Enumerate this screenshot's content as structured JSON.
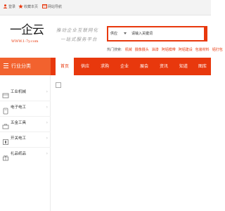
{
  "topbar": {
    "links": [
      {
        "label": "登录",
        "icon": "user-icon"
      },
      {
        "label": "收藏本页",
        "icon": "star-icon"
      },
      {
        "label": "网站导航",
        "icon": "sitemap-icon"
      }
    ]
  },
  "header": {
    "logo_text": "一企云",
    "logo_url": "WWW.1-7y.com",
    "slogan_line1": "推动企业互联网化",
    "slogan_line2": "一站式服务平台"
  },
  "search": {
    "type_label": "供应",
    "placeholder": "请输入关键词"
  },
  "hot": {
    "label": "热门搜索:",
    "items": [
      "机械",
      "摄像摄头",
      "油漆",
      "阿铝模带",
      "阿铝建设",
      "包装材料",
      "铝打包"
    ]
  },
  "nav": {
    "category_title": "行业分类",
    "tabs": [
      "首页",
      "供应",
      "求购",
      "企业",
      "展会",
      "资讯",
      "知道",
      "图库"
    ]
  },
  "categories": [
    {
      "label": "工业机械",
      "icon": "machine-icon"
    },
    {
      "label": "电子电工",
      "icon": "electronics-icon"
    },
    {
      "label": "五金工具",
      "icon": "hardware-tools-icon"
    },
    {
      "label": "开关电工",
      "icon": "switch-icon"
    },
    {
      "label": "礼品纸品",
      "icon": "gift-icon"
    }
  ],
  "colors": {
    "brand": "#e8380d",
    "category_header": "#f2622e"
  }
}
